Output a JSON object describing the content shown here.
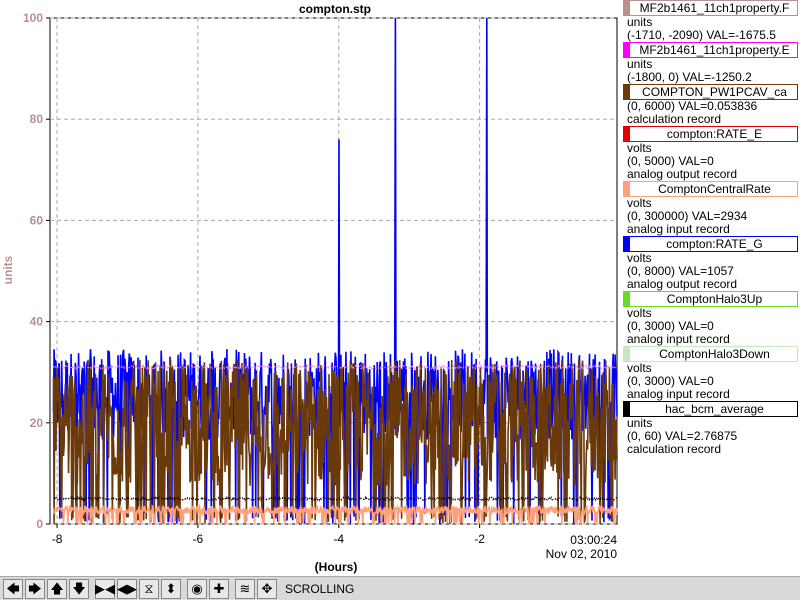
{
  "chart_data": {
    "type": "line",
    "title": "compton.stp",
    "xlabel": "(Hours)",
    "ylabel": "units",
    "xlim": [
      -8.1,
      -0.05
    ],
    "ylim": [
      0,
      100
    ],
    "x_ticks": [
      -8,
      -6,
      -4,
      -2
    ],
    "y_ticks": [
      0,
      20,
      40,
      60,
      80,
      100
    ],
    "x_tick_labels": [
      "-8",
      "-6",
      "-4",
      "-2"
    ],
    "y_tick_labels": [
      "0",
      "20",
      "40",
      "60",
      "80",
      "100"
    ],
    "time_label": "03:00:24",
    "date_label": "Nov 02, 2010",
    "grid": true,
    "series": [
      {
        "name": "compton:RATE_G",
        "color": "#0000ff",
        "style": "noisy",
        "base": 22,
        "amp": 18,
        "spikes": [
          [
            -4.0,
            76
          ],
          [
            -3.2,
            100
          ],
          [
            -1.9,
            100
          ]
        ]
      },
      {
        "name": "COMPTON_PW1PCAV_ca",
        "color": "#6b3a0a",
        "style": "noisy",
        "base": 15,
        "amp": 25
      },
      {
        "name": "ComptonCentralRate",
        "color": "#ffa07a",
        "style": "noisy",
        "base": 2.5,
        "amp": 1.5
      },
      {
        "name": "MF2b1461_11ch1property.E",
        "color": "#ee82ee",
        "style": "flat",
        "level": 31
      },
      {
        "name": "hac_bcm_average",
        "color": "#000000",
        "style": "flat",
        "level": 5
      }
    ]
  },
  "legend": [
    {
      "name": "MF2b1461_11ch1property.F",
      "color": "#bc8f8f",
      "lines": [
        "units",
        "(-1710, -2090) VAL=-1675.5"
      ]
    },
    {
      "name": "MF2b1461_11ch1property.E",
      "color": "#ff00ff",
      "lines": [
        "units",
        "(-1800, 0) VAL=-1250.2"
      ]
    },
    {
      "name": "COMPTON_PW1PCAV_ca",
      "color": "#6b3a0a",
      "lines": [
        "(0, 6000) VAL=0.053836",
        "calculation record"
      ]
    },
    {
      "name": "compton:RATE_E",
      "color": "#e00000",
      "lines": [
        "volts",
        "(0, 5000) VAL=0",
        "analog output record"
      ]
    },
    {
      "name": "ComptonCentralRate",
      "color": "#ffa07a",
      "lines": [
        "volts",
        "(0, 300000) VAL=2934",
        "analog input record"
      ]
    },
    {
      "name": "compton:RATE_G",
      "color": "#0000ff",
      "lines": [
        "volts",
        "(0, 8000) VAL=1057",
        "analog output record"
      ]
    },
    {
      "name": "ComptonHalo3Up",
      "color": "#66dd22",
      "lines": [
        "volts",
        "(0, 3000) VAL=0",
        "analog input record"
      ]
    },
    {
      "name": "ComptonHalo3Down",
      "color": "#c8e6c0",
      "lines": [
        "volts",
        "(0, 3000) VAL=0",
        "analog input record"
      ]
    },
    {
      "name": "hac_bcm_average",
      "color": "#000000",
      "lines": [
        "units",
        "(0, 60) VAL=2.76875",
        "calculation record"
      ]
    }
  ],
  "toolbar": {
    "buttons": [
      "scroll-left",
      "scroll-right",
      "scroll-up",
      "scroll-down",
      "zoom-in-x",
      "zoom-out-x",
      "zoom-in-y",
      "zoom-out-y",
      "reset",
      "add",
      "autoscale"
    ],
    "status": "SCROLLING"
  },
  "colors": {
    "axis_label": "#bc8f8f",
    "grid": "#aaaaaa"
  }
}
